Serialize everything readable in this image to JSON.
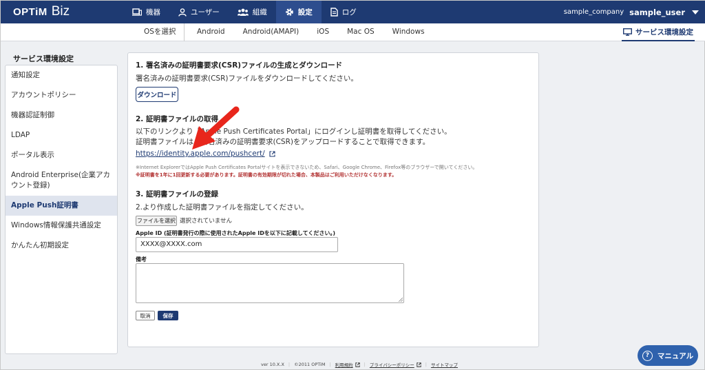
{
  "header": {
    "logo_brand": "OPTiM",
    "logo_product": "Biz",
    "nav": [
      {
        "label": "機器",
        "icon": "device-icon"
      },
      {
        "label": "ユーザー",
        "icon": "user-icon"
      },
      {
        "label": "組織",
        "icon": "organization-icon"
      },
      {
        "label": "設定",
        "icon": "gear-icon"
      },
      {
        "label": "ログ",
        "icon": "log-icon"
      }
    ],
    "company": "sample_company",
    "user": "sample_user"
  },
  "subnav": {
    "os_label": "OSを選択",
    "tabs": [
      "Android",
      "Android(AMAPI)",
      "iOS",
      "Mac OS",
      "Windows"
    ],
    "service_settings": "サービス環境設定"
  },
  "sidebar": {
    "title": "サービス環境設定",
    "items": [
      "通知設定",
      "アカウントポリシー",
      "機器認証制御",
      "LDAP",
      "ポータル表示",
      "Android Enterprise(企業アカウント登録)",
      "Apple Push証明書",
      "Windows情報保護共通設定",
      "かんたん初期設定"
    ],
    "active_index": 6
  },
  "main": {
    "s1_title": "1. 署名済みの証明書要求(CSR)ファイルの生成とダウンロード",
    "s1_desc": "署名済みの証明書要求(CSR)ファイルをダウンロードしてください。",
    "download_button": "ダウンロード",
    "s2_title": "2. 証明書ファイルの取得",
    "s2_desc1": "以下のリンクより「Apple Push Certificates Portal」にログインし証明書を取得してください。",
    "s2_desc2": "証明書ファイルは、署名済みの証明書要求(CSR)をアップロードすることで取得できます。",
    "link": "https://identity.apple.com/pushcert/",
    "note1": "※Internet ExplorerではApple Push Certificates Portalサイトを表示できないため、Safari、Google Chrome、Firefox等のブラウザーで開いてください。",
    "note2": "※証明書を1年に1回更新する必要があります。証明書の有効期限が切れた場合、本製品はご利用いただけなくなります。",
    "s3_title": "3. 証明書ファイルの登録",
    "s3_desc": "2.より作成した証明書ファイルを指定してください。",
    "file_button": "ファイルを選択",
    "file_status": "選択されていません",
    "apple_id_label": "Apple ID (証明書発行の際に使用されたApple IDを以下に記載してください。)",
    "apple_id_value": "XXXX@XXXX.com",
    "memo_label": "備考",
    "cancel_button": "取消",
    "save_button": "保存"
  },
  "footer": {
    "version": "ver 10.X.X",
    "copyright": "©2011 OPTiM",
    "terms": "利用規約",
    "privacy": "プライバシーポリシー",
    "sitemap": "サイトマップ"
  },
  "manual_button": "マニュアル",
  "colors": {
    "navy": "#1e3a72",
    "accent_red": "#e8261c",
    "manual_blue": "#2f62ad"
  }
}
